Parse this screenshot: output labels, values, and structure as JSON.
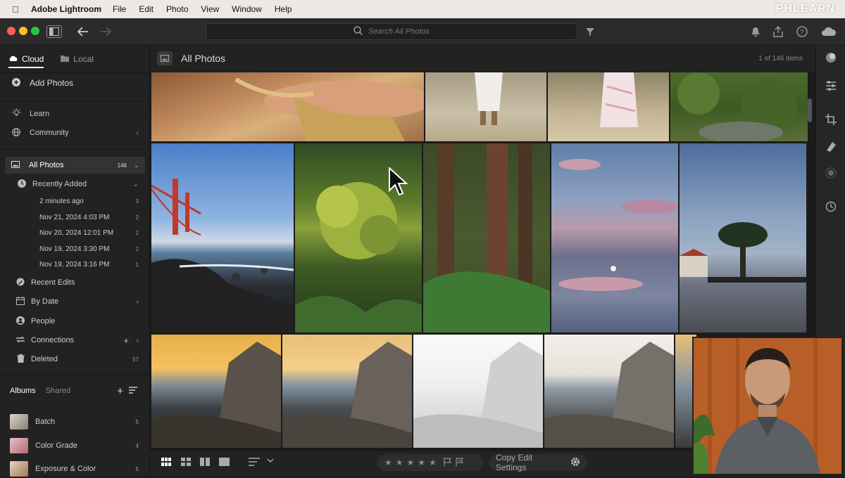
{
  "menubar": {
    "app_name": "Adobe Lightroom",
    "menus": [
      "File",
      "Edit",
      "Photo",
      "View",
      "Window",
      "Help"
    ],
    "watermark": "PHLEARN"
  },
  "toolbar": {
    "search_placeholder": "Search All Photos"
  },
  "sidebar": {
    "tab_cloud": "Cloud",
    "tab_local": "Local",
    "add_photos": "Add Photos",
    "learn": "Learn",
    "community": "Community",
    "all_photos": "All Photos",
    "all_photos_count": "146",
    "recently_added": "Recently Added",
    "recent_items": [
      {
        "label": "2 minutes ago",
        "count": "3"
      },
      {
        "label": "Nov 21, 2024 4:03 PM",
        "count": "2"
      },
      {
        "label": "Nov 20, 2024 12:01 PM",
        "count": "2"
      },
      {
        "label": "Nov 19, 2024 3:30 PM",
        "count": "2"
      },
      {
        "label": "Nov 19, 2024 3:16 PM",
        "count": "1"
      }
    ],
    "recent_edits": "Recent Edits",
    "by_date": "By Date",
    "people": "People",
    "connections": "Connections",
    "deleted": "Deleted",
    "deleted_count": "57",
    "albums_tab": "Albums",
    "shared_tab": "Shared",
    "albums": [
      {
        "label": "Batch",
        "count": "5"
      },
      {
        "label": "Color Grade",
        "count": "4"
      },
      {
        "label": "Exposure & Color",
        "count": "5"
      }
    ]
  },
  "main": {
    "title": "All Photos",
    "item_count": "1 of 146 items"
  },
  "bottombar": {
    "copy_edit_settings": "Copy Edit Settings",
    "stars": [
      "★",
      "★",
      "★",
      "★",
      "★"
    ]
  }
}
